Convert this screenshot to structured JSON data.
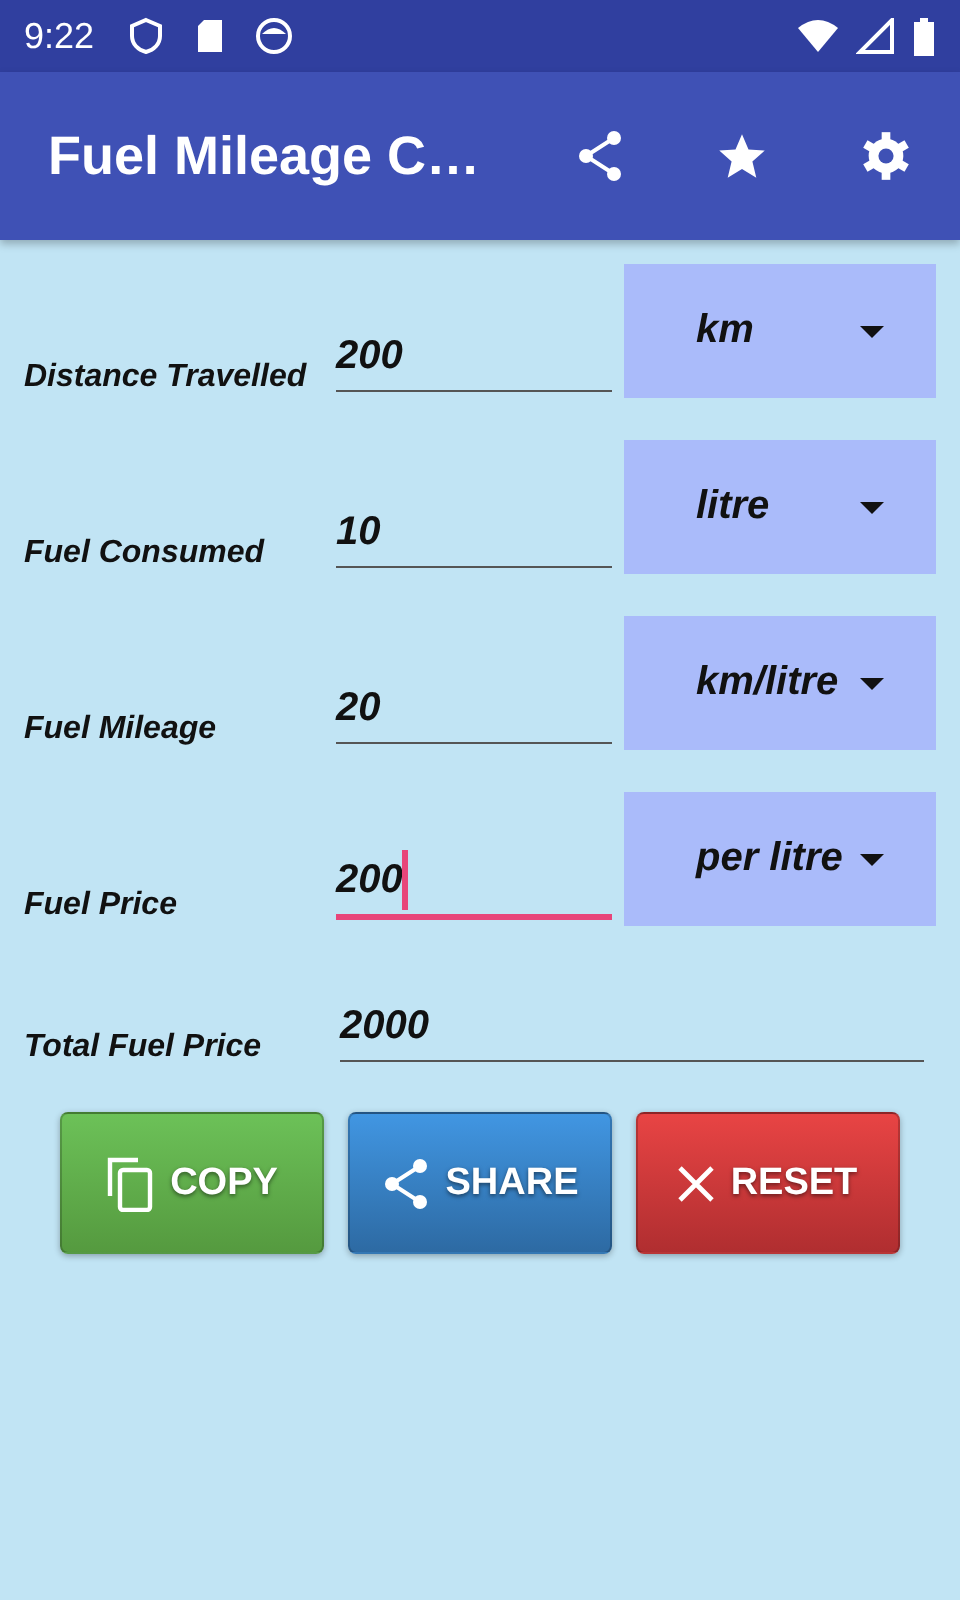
{
  "status_bar": {
    "time": "9:22"
  },
  "app_bar": {
    "title": "Fuel Mileage C…"
  },
  "fields": [
    {
      "label": "Distance Travelled",
      "value": "200",
      "unit": "km",
      "focused": false
    },
    {
      "label": "Fuel Consumed",
      "value": "10",
      "unit": "litre",
      "focused": false
    },
    {
      "label": "Fuel Mileage",
      "value": "20",
      "unit": "km/litre",
      "focused": false
    },
    {
      "label": "Fuel Price",
      "value": "200",
      "unit": "per litre",
      "focused": true
    }
  ],
  "total": {
    "label": "Total Fuel Price",
    "value": "2000"
  },
  "buttons": [
    {
      "kind": "copy",
      "label": "COPY"
    },
    {
      "kind": "share",
      "label": "SHARE"
    },
    {
      "kind": "reset",
      "label": "RESET"
    }
  ]
}
